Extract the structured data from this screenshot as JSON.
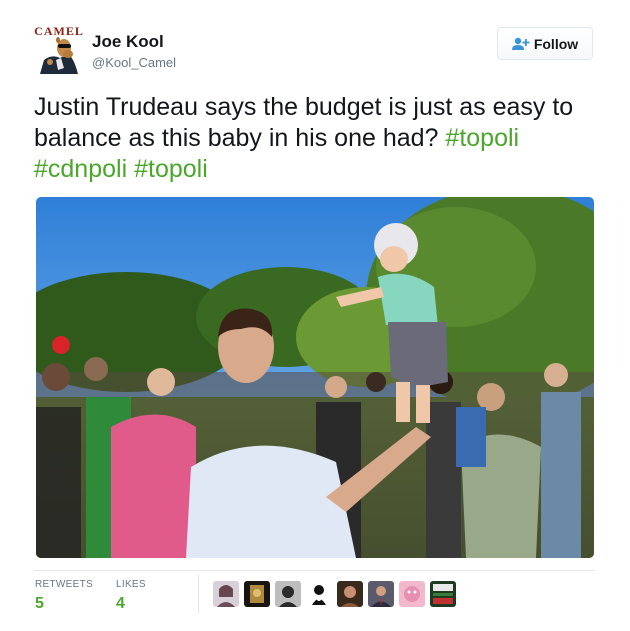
{
  "author": {
    "logo_text": "CAMEL",
    "name": "Joe Kool",
    "handle": "@Kool_Camel"
  },
  "follow_button": {
    "label": "Follow",
    "icon": "add-user-icon"
  },
  "tweet": {
    "text_plain": "Justin Trudeau says the budget is just as easy to balance as this baby in his one had?",
    "hashtags": [
      "#topoli",
      "#cdnpoli",
      "#topoli"
    ]
  },
  "stats": {
    "retweets_label": "RETWEETS",
    "retweets_value": "5",
    "likes_label": "LIKES",
    "likes_value": "4"
  },
  "likers": [
    {
      "icon": "avatar-woman-icon",
      "color": "#6b4a5a"
    },
    {
      "icon": "avatar-gold-icon",
      "color": "#b08a3c"
    },
    {
      "icon": "avatar-portrait-icon",
      "color": "#2b2b2b"
    },
    {
      "icon": "avatar-cartoon-icon",
      "color": "#ffffff"
    },
    {
      "icon": "avatar-man-icon",
      "color": "#3a2a1e"
    },
    {
      "icon": "avatar-suit-icon",
      "color": "#2a2a3a"
    },
    {
      "icon": "avatar-pink-icon",
      "color": "#e68fb0"
    },
    {
      "icon": "avatar-nhs-icon",
      "color": "#1c3a20"
    }
  ],
  "colors": {
    "hashtag": "#4aa72c",
    "stat_value": "#4aa72c",
    "muted": "#657786",
    "border": "#e1e8ed"
  }
}
